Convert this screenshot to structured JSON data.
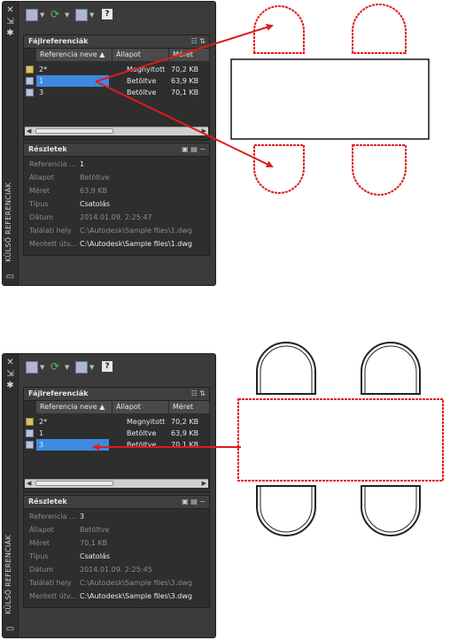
{
  "palette_title": "KÜLSŐ REFERENCIÁK",
  "section_file_refs": "Fájlreferenciák",
  "section_details": "Részletek",
  "columns": [
    "Referencia neve",
    "Állapot",
    "Méret"
  ],
  "screen1": {
    "rows": [
      {
        "name": "2*",
        "status": "Megnyitott",
        "size": "70,2 KB",
        "icon": "drawing-modified-icon",
        "selected": false
      },
      {
        "name": "1",
        "status": "Betöltve",
        "size": "63,9 KB",
        "icon": "dwg-reference-icon",
        "selected": true
      },
      {
        "name": "3",
        "status": "Betöltve",
        "size": "70,1 KB",
        "icon": "dwg-reference-icon",
        "selected": false
      }
    ],
    "details": [
      {
        "label": "Referencia ...",
        "value": "1"
      },
      {
        "label": "Állapot",
        "value": "Betöltve"
      },
      {
        "label": "Méret",
        "value": "63,9 KB"
      },
      {
        "label": "Típus",
        "value": "Csatolás"
      },
      {
        "label": "Dátum",
        "value": "2014.01.09. 2:25:47"
      },
      {
        "label": "Találati hely",
        "value": "C:\\Autodesk\\Sample files\\1.dwg"
      },
      {
        "label": "Mentett útv...",
        "value": "C:\\Autodesk\\Sample files\\1.dwg"
      }
    ]
  },
  "screen2": {
    "rows": [
      {
        "name": "2*",
        "status": "Megnyitott",
        "size": "70,2 KB",
        "icon": "drawing-modified-icon",
        "selected": false
      },
      {
        "name": "1",
        "status": "Betöltve",
        "size": "63,9 KB",
        "icon": "dwg-reference-icon",
        "selected": false
      },
      {
        "name": "3",
        "status": "Betöltve",
        "size": "70,1 KB",
        "icon": "dwg-reference-icon",
        "selected": true
      }
    ],
    "details": [
      {
        "label": "Referencia ...",
        "value": "3"
      },
      {
        "label": "Állapot",
        "value": "Betöltve"
      },
      {
        "label": "Méret",
        "value": "70,1 KB"
      },
      {
        "label": "Típus",
        "value": "Csatolás"
      },
      {
        "label": "Dátum",
        "value": "2014.01.09. 2:25:45"
      },
      {
        "label": "Találati hely",
        "value": "C:\\Autodesk\\Sample files\\3.dwg"
      },
      {
        "label": "Mentett útv...",
        "value": "C:\\Autodesk\\Sample files\\3.dwg"
      }
    ]
  },
  "icons": [
    "close-icon",
    "pin-icon",
    "settings-icon",
    "attach-dwg-icon",
    "refresh-icon",
    "change-path-icon",
    "help-icon",
    "list-view-icon",
    "tree-view-icon",
    "preview-icon",
    "details-icon",
    "collapse-icon"
  ],
  "colors": {
    "highlight": "#e01b1b",
    "selection": "#3c8be0",
    "panel": "#3b3b3b"
  }
}
